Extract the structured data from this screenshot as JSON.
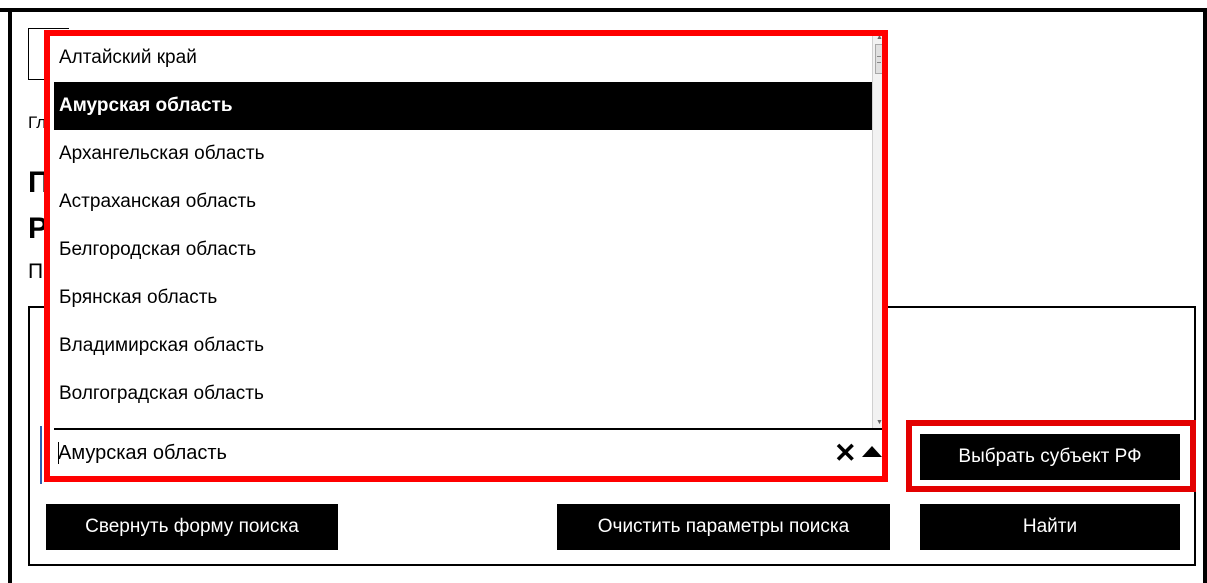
{
  "background": {
    "breadcrumb_partial": "Гл",
    "title_partial_line1": "П",
    "title_partial_line2": "Р",
    "subtitle_partial": "П"
  },
  "region_select": {
    "options": [
      {
        "label": "Алтайский край",
        "selected": false
      },
      {
        "label": "Амурская область",
        "selected": true
      },
      {
        "label": "Архангельская область",
        "selected": false
      },
      {
        "label": "Астраханская область",
        "selected": false
      },
      {
        "label": "Белгородская область",
        "selected": false
      },
      {
        "label": "Брянская область",
        "selected": false
      },
      {
        "label": "Владимирская область",
        "selected": false
      },
      {
        "label": "Волгоградская область",
        "selected": false
      }
    ],
    "value": "Амурская область",
    "clear_icon": "close-icon",
    "toggle_icon": "triangle-up-icon"
  },
  "buttons": {
    "choose_region": "Выбрать субъект РФ",
    "collapse_form": "Свернуть форму поиска",
    "clear_params": "Очистить параметры поиска",
    "find": "Найти"
  },
  "colors": {
    "highlight": "#ff0000",
    "button_bg": "#000000",
    "button_text": "#ffffff",
    "selected_option_bg": "#000000"
  }
}
